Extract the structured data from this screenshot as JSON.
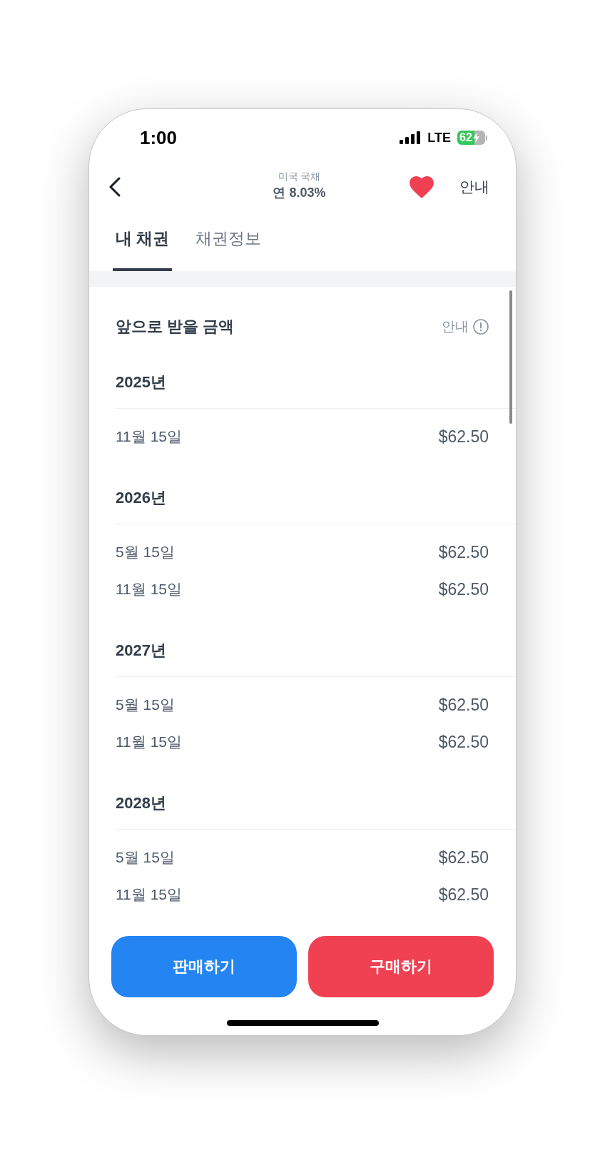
{
  "status_bar": {
    "time": "1:00",
    "network": "LTE",
    "battery": "62"
  },
  "header": {
    "subtitle": "미국 국채",
    "title": "연 8.03%",
    "favorited": true,
    "info_label": "안내"
  },
  "tabs": [
    {
      "label": "내 채권",
      "selected": true
    },
    {
      "label": "채권정보",
      "selected": false
    }
  ],
  "schedule": {
    "title": "앞으로 받을 금액",
    "info_label": "안내",
    "years": [
      {
        "year": "2025년",
        "payments": [
          {
            "date": "11월 15일",
            "amount": "$62.50"
          }
        ]
      },
      {
        "year": "2026년",
        "payments": [
          {
            "date": "5월 15일",
            "amount": "$62.50"
          },
          {
            "date": "11월 15일",
            "amount": "$62.50"
          }
        ]
      },
      {
        "year": "2027년",
        "payments": [
          {
            "date": "5월 15일",
            "amount": "$62.50"
          },
          {
            "date": "11월 15일",
            "amount": "$62.50"
          }
        ]
      },
      {
        "year": "2028년",
        "payments": [
          {
            "date": "5월 15일",
            "amount": "$62.50"
          },
          {
            "date": "11월 15일",
            "amount": "$62.50"
          }
        ]
      }
    ]
  },
  "actions": [
    {
      "label": "판매하기",
      "kind": "sell"
    },
    {
      "label": "구매하기",
      "kind": "buy"
    }
  ]
}
